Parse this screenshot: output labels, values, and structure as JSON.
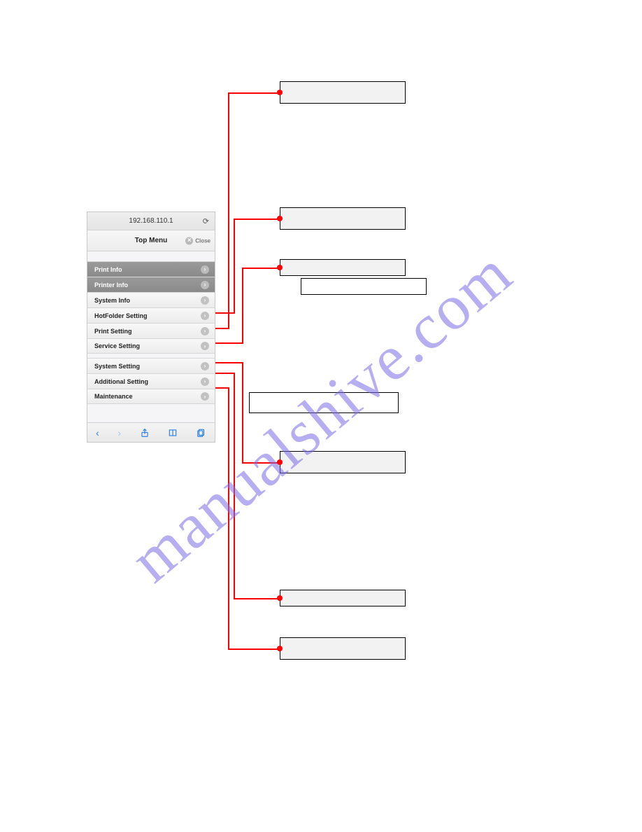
{
  "watermark": "manualshive.com",
  "phone": {
    "address": "192.168.110.1",
    "title": "Top Menu",
    "close_label": "Close",
    "items": [
      {
        "label": "Print Info",
        "dark": true
      },
      {
        "label": "Printer Info",
        "dark": true
      },
      {
        "label": "System Info"
      },
      {
        "label": "HotFolder Setting"
      },
      {
        "label": "Print Setting"
      },
      {
        "label": "Service Setting"
      }
    ],
    "items2": [
      {
        "label": "System Setting"
      },
      {
        "label": "Additional Setting"
      },
      {
        "label": "Maintenance"
      }
    ]
  }
}
